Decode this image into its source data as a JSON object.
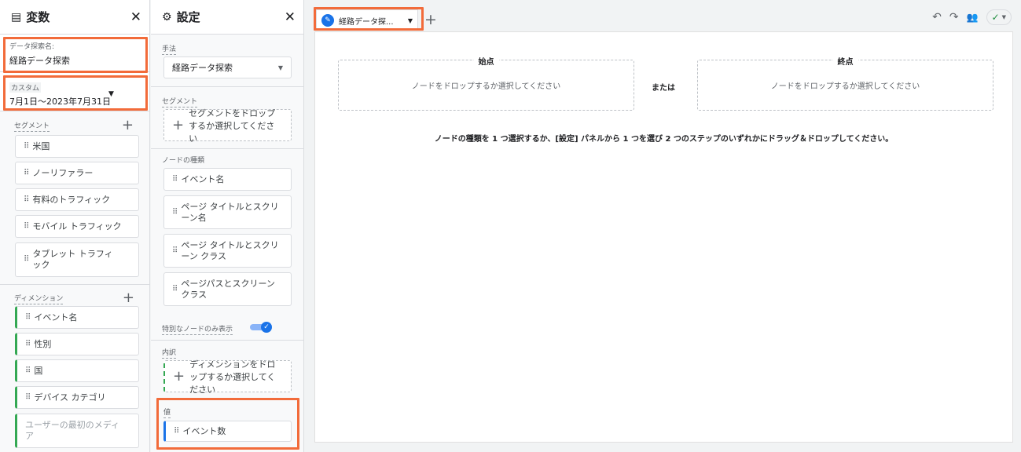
{
  "variables_panel": {
    "title": "変数",
    "close": "✕",
    "exploration_name_label": "データ探索名:",
    "exploration_name": "経路データ探索",
    "date_label": "カスタム",
    "date_range": "7月1日～2023年7月31日",
    "segments_label": "セグメント",
    "segments": [
      "米国",
      "ノーリファラー",
      "有料のトラフィック",
      "モバイル トラフィック",
      "タブレット トラフィック"
    ],
    "dimensions_label": "ディメンション",
    "dimensions": [
      "イベント名",
      "性別",
      "国",
      "デバイス カテゴリ",
      "ユーザーの最初のメディア"
    ]
  },
  "settings_panel": {
    "title": "設定",
    "close": "✕",
    "technique_label": "手法",
    "technique": "経路データ探索",
    "segment_label": "セグメント",
    "segment_drop": "セグメントをドロップするか選択してください",
    "node_type_label": "ノードの種類",
    "node_types": [
      "イベント名",
      "ページ タイトルとスクリーン名",
      "ページ タイトルとスクリーン クラス",
      "ページパスとスクリーン クラス"
    ],
    "unique_nodes_label": "特別なノードのみ表示",
    "unique_nodes_on": true,
    "breakdown_label": "内訳",
    "breakdown_drop": "ディメンションをドロップするか選択してください",
    "values_label": "値",
    "value_item": "イベント数"
  },
  "tab": {
    "label": "経路データ探...",
    "add": "+"
  },
  "toolbar": {
    "undo": "↶",
    "redo": "↷",
    "share": "👥",
    "check": "✓"
  },
  "canvas": {
    "start_label": "始点",
    "start_hint": "ノードをドロップするか選択してください",
    "or": "または",
    "end_label": "終点",
    "end_hint": "ノードをドロップするか選択してください",
    "instruction": "ノードの種類を 1 つ選択するか、[設定] パネルから 1 つを選び 2 つのステップのいずれかにドラッグ＆ドロップしてください。"
  }
}
